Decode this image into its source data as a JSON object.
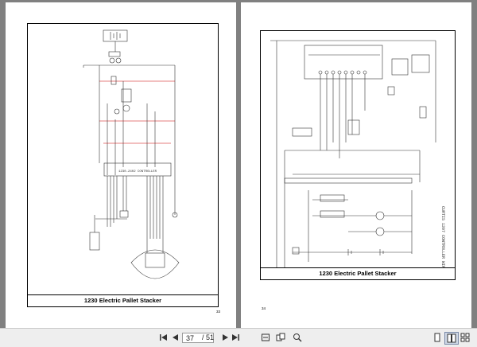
{
  "document": {
    "left_page": {
      "caption": "1230 Electric Pallet Stacker",
      "page_number": "33"
    },
    "right_page": {
      "caption": "1230 Electric Pallet Stacker",
      "page_number": "34"
    }
  },
  "toolbar": {
    "current_page": "37",
    "page_count": "/ 51",
    "first_icon": "first-page-icon",
    "prev_icon": "previous-page-icon",
    "next_icon": "next-page-icon",
    "last_icon": "last-page-icon"
  }
}
